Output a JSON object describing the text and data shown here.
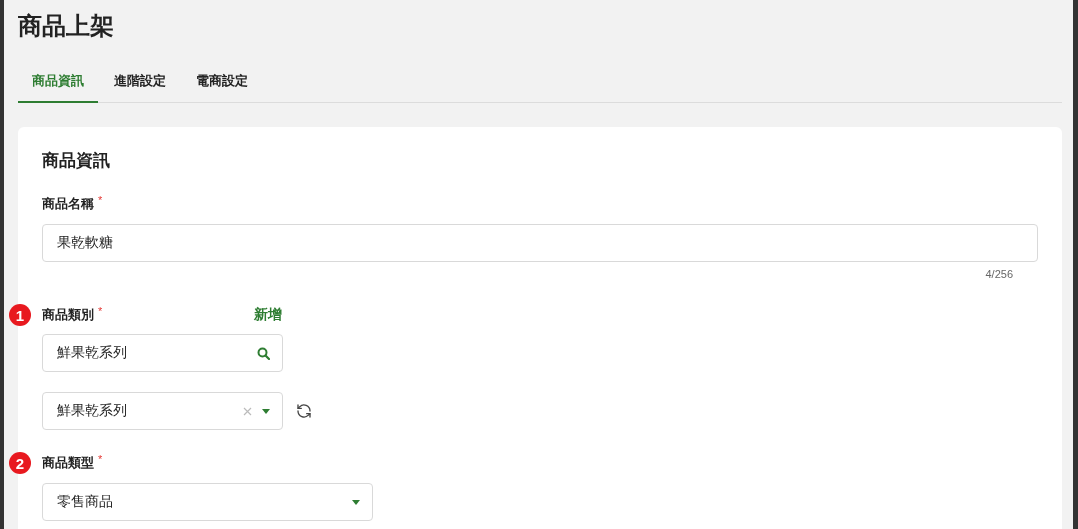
{
  "page": {
    "title": "商品上架"
  },
  "tabs": [
    {
      "label": "商品資訊",
      "selected": true
    },
    {
      "label": "進階設定",
      "selected": false
    },
    {
      "label": "電商設定",
      "selected": false
    }
  ],
  "section": {
    "title": "商品資訊",
    "fields": [
      {
        "kind": "text",
        "label": "商品名稱",
        "required_mark": "*",
        "value": "果乾軟糖",
        "counter": "4/256"
      },
      {
        "kind": "search",
        "step": "1",
        "label": "商品類別",
        "required_mark": "*",
        "action": "新增",
        "value": "鮮果乾系列"
      },
      {
        "kind": "picker",
        "value": "鮮果乾系列",
        "clearable": true,
        "refresh": true
      },
      {
        "kind": "select",
        "step": "2",
        "label": "商品類型",
        "required_mark": "*",
        "value": "零售商品"
      }
    ]
  }
}
